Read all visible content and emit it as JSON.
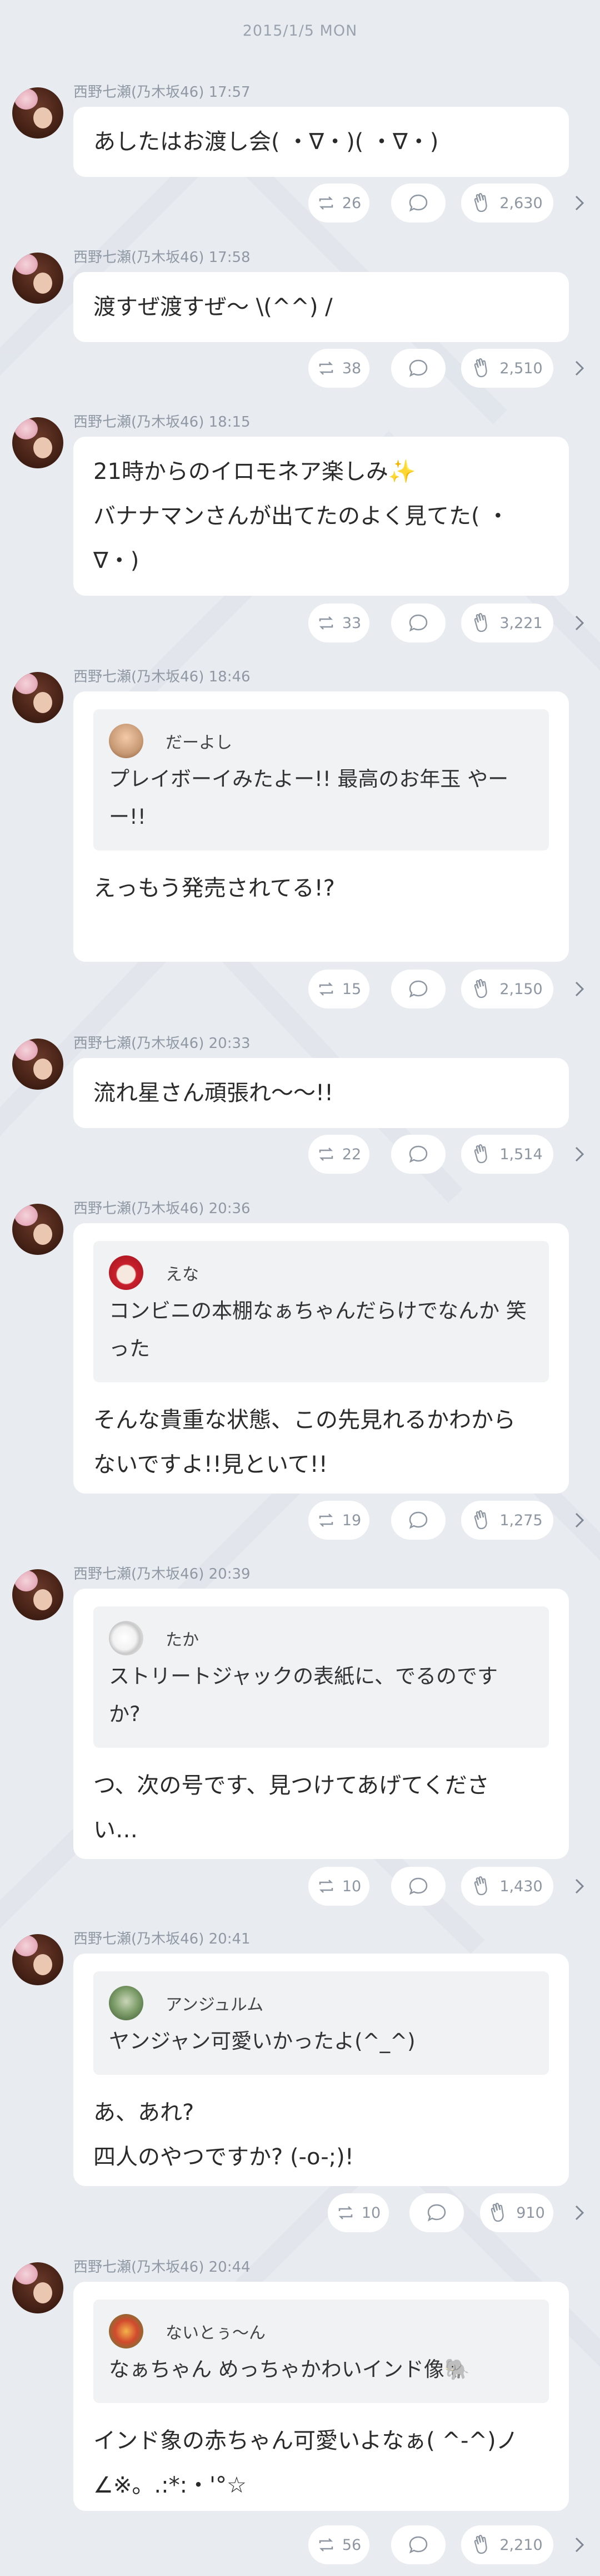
{
  "date": "2015/1/5 MON",
  "author": "西野七瀬(乃木坂46)",
  "posts": [
    {
      "time": "17:57",
      "text": "あしたはお渡し会( ・∇・)( ・∇・)",
      "retweets": "26",
      "likes": "2,630"
    },
    {
      "time": "17:58",
      "text": "渡すぜ渡すぜ～ \\(^^) /",
      "retweets": "38",
      "likes": "2,510"
    },
    {
      "time": "18:15",
      "text": "21時からのイロモネア楽しみ✨\nバナナマンさんが出てたのよく見てた( ・\n∇・)",
      "retweets": "33",
      "likes": "3,221"
    },
    {
      "time": "18:46",
      "quote_name": "だーよし",
      "quote_text": "プレイボーイみたよー!! 最高のお年玉\nやーー!!",
      "text": "えっもう発売されてる!?",
      "retweets": "15",
      "likes": "2,150"
    },
    {
      "time": "20:33",
      "text": "流れ星さん頑張れ～～!!",
      "retweets": "22",
      "likes": "1,514"
    },
    {
      "time": "20:36",
      "quote_name": "えな",
      "quote_text": "コンビニの本棚なぁちゃんだらけでなんか\n笑った",
      "text": "そんな貴重な状態、この先見れるかわから\nないですよ!!見といて!!",
      "retweets": "19",
      "likes": "1,275"
    },
    {
      "time": "20:39",
      "quote_name": "たか",
      "quote_text": "ストリートジャックの表紙に、でるのです\nか?",
      "text": "つ、次の号です、見つけてあげてくださ\nい…",
      "retweets": "10",
      "likes": "1,430"
    },
    {
      "time": "20:41",
      "quote_name": "アンジュルム",
      "quote_text": "ヤンジャン可愛いかったよ(^_^)",
      "text": "あ、あれ?\n四人のやつですか? (-o-;)!",
      "retweets": "10",
      "likes": "910"
    },
    {
      "time": "20:44",
      "quote_name": "ないとぅ〜ん",
      "quote_text": "なぁちゃん めっちゃかわいインド像🐘",
      "text": "インド象の赤ちゃん可愛いよなぁ( ^-^)ノ\n∠※。.:*:・'°☆",
      "retweets": "56",
      "likes": "2,210"
    }
  ],
  "colors": {
    "background": "#e8ecf1",
    "bubble": "#ffffff",
    "quote": "#f1f2f4",
    "meta": "#8f98a3"
  },
  "icons": {
    "retweet": "retweet-icon",
    "comment": "comment-icon",
    "like": "clap-icon",
    "more": "chevron-right-icon"
  }
}
